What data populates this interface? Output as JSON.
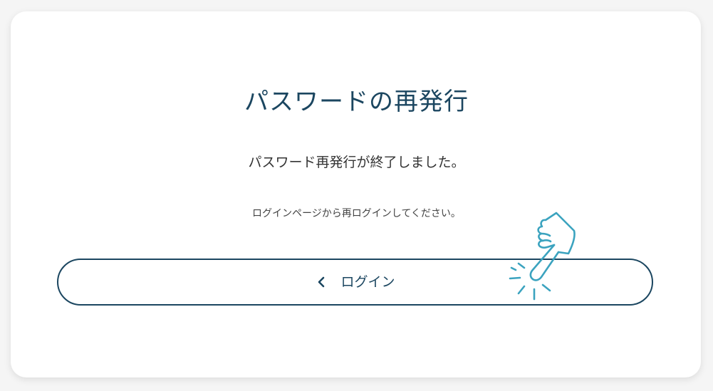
{
  "page": {
    "title": "パスワードの再発行",
    "message": "パスワード再発行が終了しました。",
    "sub_message": "ログインページから再ログインしてください。"
  },
  "login_button": {
    "label": "ログイン",
    "icon": "chevron-left-icon"
  },
  "decoration": {
    "icon": "tapping-hand-icon"
  },
  "colors": {
    "primary": "#1b4660",
    "accent": "#3ba3bf",
    "text": "#333333"
  }
}
